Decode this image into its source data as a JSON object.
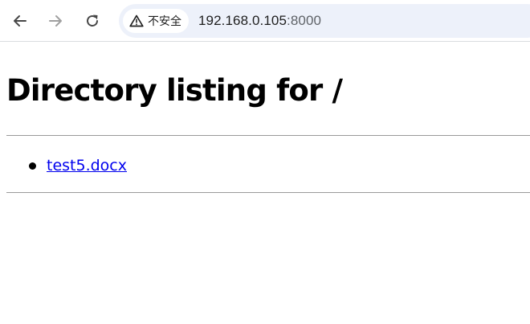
{
  "browser": {
    "security_label": "不安全",
    "url_host": "192.168.0.105",
    "url_port": ":8000",
    "icons": {
      "back": "arrow-left",
      "forward": "arrow-right",
      "reload": "reload",
      "security": "warning-triangle"
    },
    "colors": {
      "omnibox_bg": "#edf1fa",
      "forward_disabled": "#a0a0a0"
    }
  },
  "page": {
    "title": "Directory listing for /",
    "files": [
      {
        "name": "test5.docx"
      }
    ],
    "colors": {
      "link": "#0000ee"
    }
  }
}
